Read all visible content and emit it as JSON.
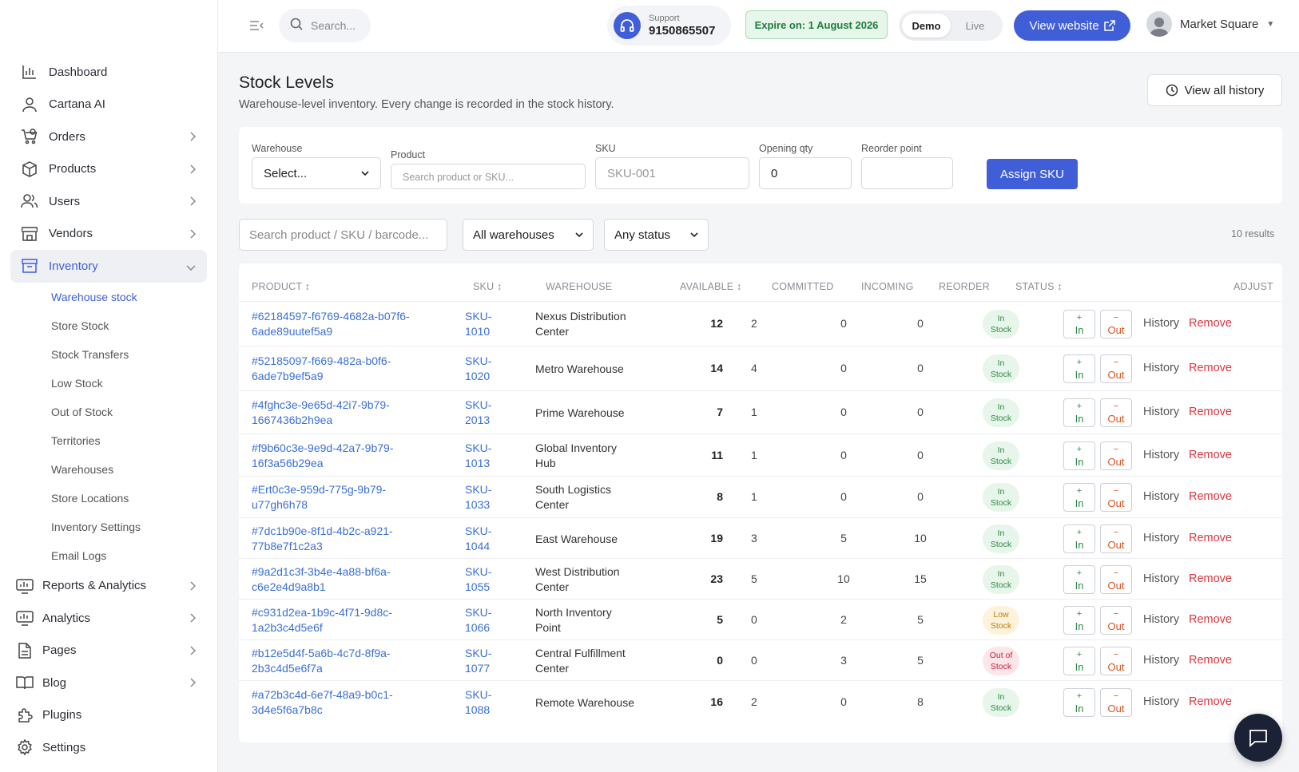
{
  "sidebar": {
    "items": [
      {
        "label": "Dashboard",
        "icon": "bar-chart-icon",
        "chevron": false
      },
      {
        "label": "Cartana AI",
        "icon": "person-icon",
        "chevron": false
      },
      {
        "label": "Orders",
        "icon": "cart-icon",
        "chevron": true
      },
      {
        "label": "Products",
        "icon": "box-icon",
        "chevron": true
      },
      {
        "label": "Users",
        "icon": "users-icon",
        "chevron": true
      },
      {
        "label": "Vendors",
        "icon": "store-icon",
        "chevron": true
      },
      {
        "label": "Inventory",
        "icon": "archive-icon",
        "chevron": true,
        "active": true
      }
    ],
    "inventory_sub": [
      {
        "label": "Warehouse stock",
        "active": true
      },
      {
        "label": "Store Stock"
      },
      {
        "label": "Stock Transfers"
      },
      {
        "label": "Low Stock"
      },
      {
        "label": "Out of Stock"
      },
      {
        "label": "Territories"
      },
      {
        "label": "Warehouses"
      },
      {
        "label": "Store Locations"
      },
      {
        "label": "Inventory Settings"
      },
      {
        "label": "Email Logs"
      }
    ],
    "bottom_items": [
      {
        "label": "Reports & Analytics",
        "icon": "monitor-chart-icon",
        "chevron": true
      },
      {
        "label": "Analytics",
        "icon": "monitor-chart-icon",
        "chevron": true
      },
      {
        "label": "Pages",
        "icon": "page-icon",
        "chevron": true
      },
      {
        "label": "Blog",
        "icon": "book-icon",
        "chevron": true
      },
      {
        "label": "Plugins",
        "icon": "puzzle-icon",
        "chevron": false
      },
      {
        "label": "Settings",
        "icon": "gear-icon",
        "chevron": false
      }
    ]
  },
  "header": {
    "search_placeholder": "Search...",
    "support_label": "Support",
    "support_phone": "9150865507",
    "expire_text": "Expire on: 1 August 2026",
    "mode_demo": "Demo",
    "mode_live": "Live",
    "view_website": "View website",
    "user_name": "Market Square"
  },
  "page": {
    "title": "Stock Levels",
    "subtitle": "Warehouse-level inventory. Every change is recorded in the stock history.",
    "history_button": "View all history"
  },
  "assign_form": {
    "warehouse_label": "Warehouse",
    "warehouse_value": "Select...",
    "product_label": "Product",
    "product_placeholder": "Search product or SKU...",
    "sku_label": "SKU",
    "sku_placeholder": "SKU-001",
    "opening_label": "Opening qty",
    "opening_value": "0",
    "reorder_label": "Reorder point",
    "reorder_value": "",
    "submit": "Assign SKU"
  },
  "filters": {
    "search_placeholder": "Search product / SKU / barcode...",
    "warehouse_value": "All warehouses",
    "status_value": "Any status",
    "results": "10 results"
  },
  "table": {
    "headers": {
      "product": "PRODUCT ↕",
      "sku": "SKU ↕",
      "warehouse": "WAREHOUSE",
      "available": "AVAILABLE ↕",
      "committed": "COMMITTED",
      "incoming": "INCOMING",
      "reorder": "REORDER",
      "status": "STATUS ↕",
      "adjust": "ADJUST"
    },
    "in_label": "In",
    "out_label": "Out",
    "history_label": "History",
    "remove_label": "Remove",
    "rows": [
      {
        "p1": "#62184597-f6769-4682a-b07f6-",
        "p2": "6ade89uutef5a9",
        "s1": "SKU-",
        "s2": "1010",
        "w1": "Nexus Distribution",
        "w2": "Center",
        "available": "12",
        "committed": "2",
        "incoming": "0",
        "reorder": "0",
        "st1": "In",
        "st2": "Stock",
        "status": "in"
      },
      {
        "p1": "#52185097-f669-482a-b0f6-",
        "p2": "6ade7b9ef5a9",
        "s1": "SKU-",
        "s2": "1020",
        "w1": "Metro Warehouse",
        "w2": "",
        "available": "14",
        "committed": "4",
        "incoming": "0",
        "reorder": "0",
        "st1": "In",
        "st2": "Stock",
        "status": "in"
      },
      {
        "p1": "#4fghc3e-9e65d-42i7-9b79-",
        "p2": "1667436b2h9ea",
        "s1": "SKU-",
        "s2": "2013",
        "w1": "Prime Warehouse",
        "w2": "",
        "available": "7",
        "committed": "1",
        "incoming": "0",
        "reorder": "0",
        "st1": "In",
        "st2": "Stock",
        "status": "in"
      },
      {
        "p1": "#f9b60c3e-9e9d-42a7-9b79-",
        "p2": "16f3a56b29ea",
        "s1": "SKU-",
        "s2": "1013",
        "w1": "Global Inventory",
        "w2": "Hub",
        "available": "11",
        "committed": "1",
        "incoming": "0",
        "reorder": "0",
        "st1": "In",
        "st2": "Stock",
        "status": "in"
      },
      {
        "p1": "#Ert0c3e-959d-775g-9b79-",
        "p2": "u77gh6h78",
        "s1": "SKU-",
        "s2": "1033",
        "w1": "South Logistics",
        "w2": "Center",
        "available": "8",
        "committed": "1",
        "incoming": "0",
        "reorder": "0",
        "st1": "In",
        "st2": "Stock",
        "status": "in"
      },
      {
        "p1": "#7dc1b90e-8f1d-4b2c-a921-",
        "p2": "77b8e7f1c2a3",
        "s1": "SKU-",
        "s2": "1044",
        "w1": "East Warehouse",
        "w2": "",
        "available": "19",
        "committed": "3",
        "incoming": "5",
        "reorder": "10",
        "st1": "In",
        "st2": "Stock",
        "status": "in"
      },
      {
        "p1": "#9a2d1c3f-3b4e-4a88-bf6a-",
        "p2": "c6e2e4d9a8b1",
        "s1": "SKU-",
        "s2": "1055",
        "w1": "West Distribution",
        "w2": "Center",
        "available": "23",
        "committed": "5",
        "incoming": "10",
        "reorder": "15",
        "st1": "In",
        "st2": "Stock",
        "status": "in"
      },
      {
        "p1": "#c931d2ea-1b9c-4f71-9d8c-",
        "p2": "1a2b3c4d5e6f",
        "s1": "SKU-",
        "s2": "1066",
        "w1": "North Inventory",
        "w2": "Point",
        "available": "5",
        "committed": "0",
        "incoming": "2",
        "reorder": "5",
        "st1": "Low",
        "st2": "Stock",
        "status": "low"
      },
      {
        "p1": "#b12e5d4f-5a6b-4c7d-8f9a-",
        "p2": "2b3c4d5e6f7a",
        "s1": "SKU-",
        "s2": "1077",
        "w1": "Central Fulfillment",
        "w2": "Center",
        "available": "0",
        "committed": "0",
        "incoming": "3",
        "reorder": "5",
        "st1": "Out of",
        "st2": "Stock",
        "status": "out"
      },
      {
        "p1": "#a72b3c4d-6e7f-48a9-b0c1-",
        "p2": "3d4e5f6a7b8c",
        "s1": "SKU-",
        "s2": "1088",
        "w1": "Remote Warehouse",
        "w2": "",
        "available": "16",
        "committed": "2",
        "incoming": "0",
        "reorder": "8",
        "st1": "In",
        "st2": "Stock",
        "status": "in"
      }
    ]
  },
  "colors": {
    "accent": "#3f5ed8",
    "link": "#3a6fd8",
    "danger": "#e0343e",
    "success": "#2e8b47"
  }
}
